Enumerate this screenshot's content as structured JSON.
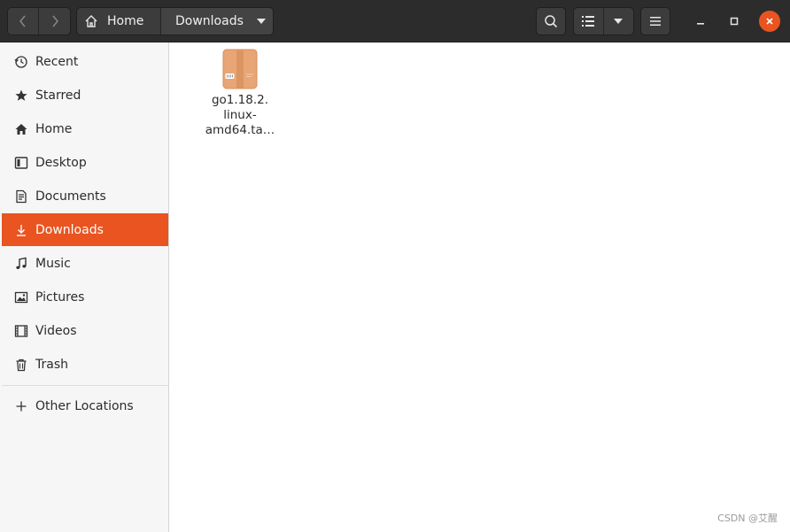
{
  "header": {
    "path": [
      {
        "label": "Home",
        "icon": "home-icon"
      },
      {
        "label": "Downloads",
        "icon": "chevron-down-icon"
      }
    ],
    "buttons": {
      "back": "back-icon",
      "forward": "forward-icon",
      "search": "search-icon",
      "view_list": "list-view-icon",
      "view_options": "chevron-down-icon",
      "menu": "hamburger-menu-icon"
    },
    "window_controls": [
      "minimize",
      "maximize",
      "close"
    ],
    "accent_color": "#e95420"
  },
  "sidebar": {
    "items": [
      {
        "label": "Recent",
        "icon": "clock-icon"
      },
      {
        "label": "Starred",
        "icon": "star-icon"
      },
      {
        "label": "Home",
        "icon": "home-icon"
      },
      {
        "label": "Desktop",
        "icon": "desktop-icon"
      },
      {
        "label": "Documents",
        "icon": "document-icon"
      },
      {
        "label": "Downloads",
        "icon": "download-icon",
        "active": true
      },
      {
        "label": "Music",
        "icon": "music-icon"
      },
      {
        "label": "Pictures",
        "icon": "picture-icon"
      },
      {
        "label": "Videos",
        "icon": "video-icon"
      },
      {
        "label": "Trash",
        "icon": "trash-icon"
      }
    ],
    "other_locations": {
      "label": "Other Locations",
      "icon": "plus-icon"
    }
  },
  "content": {
    "files": [
      {
        "name_lines": [
          "go1.18.2.",
          "linux-",
          "amd64.ta…"
        ],
        "icon": "archive-icon"
      }
    ]
  },
  "watermark": "CSDN @艾醒"
}
